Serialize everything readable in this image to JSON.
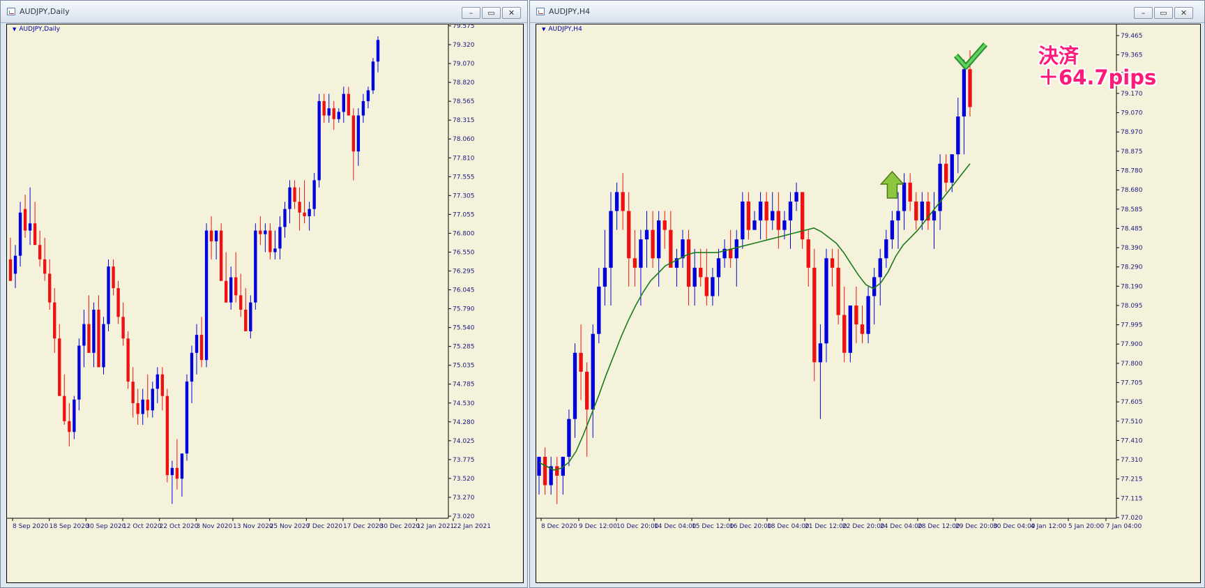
{
  "windows": [
    {
      "title": "AUDJPY,Daily",
      "chart_label": "AUDJPY,Daily",
      "y_ticks": [
        "79.575",
        "79.320",
        "79.070",
        "78.820",
        "78.565",
        "78.315",
        "78.060",
        "77.810",
        "77.555",
        "77.305",
        "77.055",
        "76.800",
        "76.550",
        "76.295",
        "76.045",
        "75.790",
        "75.540",
        "75.285",
        "75.035",
        "74.785",
        "74.530",
        "74.280",
        "74.025",
        "73.775",
        "73.520",
        "73.270",
        "73.020"
      ],
      "x_ticks": [
        "8 Sep 2020",
        "18 Sep 2020",
        "30 Sep 2020",
        "12 Oct 2020",
        "22 Oct 2020",
        "3 Nov 2020",
        "13 Nov 2020",
        "25 Nov 2020",
        "7 Dec 2020",
        "17 Dec 2020",
        "30 Dec 2020",
        "12 Jan 2021",
        "22 Jan 2021"
      ]
    },
    {
      "title": "AUDJPY,H4",
      "chart_label": "AUDJPY,H4",
      "y_ticks": [
        "79.465",
        "79.365",
        "79.265",
        "79.170",
        "79.070",
        "78.970",
        "78.875",
        "78.780",
        "78.680",
        "78.585",
        "78.485",
        "78.390",
        "78.290",
        "78.190",
        "78.095",
        "77.995",
        "77.900",
        "77.800",
        "77.705",
        "77.605",
        "77.510",
        "77.410",
        "77.310",
        "77.215",
        "77.115",
        "77.020"
      ],
      "x_ticks": [
        "8 Dec 2020",
        "9 Dec 12:00",
        "10 Dec 20:00",
        "14 Dec 04:00",
        "15 Dec 12:00",
        "16 Dec 20:00",
        "18 Dec 04:00",
        "21 Dec 12:00",
        "22 Dec 20:00",
        "24 Dec 04:00",
        "28 Dec 12:00",
        "29 Dec 20:00",
        "30 Dec 04:00",
        "4 Jan 12:00",
        "5 Jan 20:00",
        "7 Jan 04:00"
      ],
      "annotation": {
        "line1": "決済",
        "line2": "＋64.7pips"
      }
    }
  ],
  "colors": {
    "bull": "#0000dd",
    "bear": "#ee1111",
    "ma": "#1a7a1a",
    "chart_bg": "#f5f2dc",
    "axis_text": "#1a1a7a",
    "annotation": "#ff1a7a"
  },
  "icons": {
    "entry_arrow": "green-up-arrow-icon",
    "exit_check": "green-checkmark-icon"
  },
  "chart_data": [
    {
      "type": "candlestick",
      "title": "AUDJPY,Daily",
      "ylim": [
        72.9,
        79.65
      ],
      "candles": [
        [
          76.5,
          76.8,
          76.2,
          76.2
        ],
        [
          76.3,
          76.7,
          76.1,
          76.55
        ],
        [
          76.55,
          77.3,
          76.4,
          77.15
        ],
        [
          77.2,
          77.4,
          76.8,
          76.9
        ],
        [
          76.9,
          77.5,
          76.7,
          77.0
        ],
        [
          77.0,
          77.3,
          76.8,
          76.7
        ],
        [
          76.7,
          76.9,
          76.4,
          76.5
        ],
        [
          76.5,
          76.8,
          76.2,
          76.3
        ],
        [
          76.3,
          76.5,
          75.8,
          75.9
        ],
        [
          75.9,
          76.1,
          75.2,
          75.4
        ],
        [
          75.4,
          75.6,
          74.8,
          74.6
        ],
        [
          74.6,
          74.9,
          74.2,
          74.25
        ],
        [
          74.25,
          74.5,
          73.9,
          74.1
        ],
        [
          74.1,
          74.6,
          74.0,
          74.55
        ],
        [
          74.55,
          75.4,
          74.4,
          75.3
        ],
        [
          75.3,
          75.8,
          75.0,
          75.6
        ],
        [
          75.6,
          76.0,
          75.2,
          75.2
        ],
        [
          75.2,
          75.9,
          75.0,
          75.8
        ],
        [
          75.8,
          76.0,
          75.1,
          75.0
        ],
        [
          75.0,
          75.7,
          74.9,
          75.6
        ],
        [
          75.6,
          76.5,
          75.5,
          76.4
        ],
        [
          76.4,
          76.5,
          76.0,
          76.1
        ],
        [
          76.1,
          76.2,
          75.6,
          75.7
        ],
        [
          75.7,
          75.9,
          75.3,
          75.4
        ],
        [
          75.4,
          75.5,
          74.7,
          74.8
        ],
        [
          74.8,
          75.0,
          74.3,
          74.5
        ],
        [
          74.5,
          74.7,
          74.2,
          74.35
        ],
        [
          74.35,
          74.7,
          74.2,
          74.55
        ],
        [
          74.55,
          74.9,
          74.3,
          74.4
        ],
        [
          74.4,
          74.8,
          74.3,
          74.7
        ],
        [
          74.7,
          75.0,
          74.5,
          74.9
        ],
        [
          74.9,
          75.0,
          74.4,
          74.6
        ],
        [
          74.6,
          74.7,
          73.4,
          73.5
        ],
        [
          73.5,
          73.7,
          73.1,
          73.6
        ],
        [
          73.6,
          74.0,
          73.3,
          73.45
        ],
        [
          73.45,
          73.8,
          73.2,
          73.8
        ],
        [
          73.8,
          74.9,
          73.7,
          74.8
        ],
        [
          74.8,
          75.3,
          74.5,
          75.2
        ],
        [
          75.2,
          75.6,
          74.9,
          75.45
        ],
        [
          75.45,
          75.7,
          75.0,
          75.1
        ],
        [
          75.1,
          77.0,
          75.0,
          76.9
        ],
        [
          76.9,
          77.1,
          76.5,
          76.75
        ],
        [
          76.75,
          76.9,
          76.5,
          76.9
        ],
        [
          76.9,
          77.0,
          76.2,
          76.2
        ],
        [
          76.2,
          76.6,
          75.9,
          75.9
        ],
        [
          75.9,
          76.4,
          75.8,
          76.25
        ],
        [
          76.25,
          76.6,
          75.9,
          76.0
        ],
        [
          76.0,
          76.3,
          75.7,
          75.8
        ],
        [
          75.8,
          76.1,
          75.5,
          75.5
        ],
        [
          75.5,
          76.0,
          75.4,
          75.9
        ],
        [
          75.9,
          77.0,
          75.8,
          76.9
        ],
        [
          76.9,
          77.1,
          76.7,
          76.85
        ],
        [
          76.85,
          77.0,
          76.6,
          76.9
        ],
        [
          76.9,
          77.0,
          76.5,
          76.6
        ],
        [
          76.6,
          76.9,
          76.5,
          76.65
        ],
        [
          76.65,
          77.1,
          76.5,
          76.95
        ],
        [
          76.95,
          77.3,
          76.8,
          77.2
        ],
        [
          77.2,
          77.6,
          77.0,
          77.5
        ],
        [
          77.5,
          77.6,
          77.2,
          77.3
        ],
        [
          77.3,
          77.5,
          76.9,
          77.15
        ],
        [
          77.15,
          77.6,
          77.0,
          77.1
        ],
        [
          77.1,
          77.3,
          76.9,
          77.2
        ],
        [
          77.2,
          77.7,
          77.1,
          77.6
        ],
        [
          77.6,
          78.8,
          77.5,
          78.7
        ],
        [
          78.7,
          78.8,
          78.4,
          78.5
        ],
        [
          78.5,
          78.8,
          78.4,
          78.6
        ],
        [
          78.6,
          78.7,
          78.3,
          78.45
        ],
        [
          78.45,
          78.6,
          78.4,
          78.55
        ],
        [
          78.55,
          78.9,
          78.4,
          78.8
        ],
        [
          78.8,
          78.9,
          78.5,
          78.5
        ],
        [
          78.5,
          78.6,
          77.6,
          78.0
        ],
        [
          78.0,
          78.6,
          77.8,
          78.5
        ],
        [
          78.5,
          78.8,
          78.4,
          78.7
        ],
        [
          78.7,
          78.9,
          78.6,
          78.85
        ],
        [
          78.85,
          79.3,
          78.8,
          79.25
        ],
        [
          79.25,
          79.6,
          79.1,
          79.55
        ]
      ]
    },
    {
      "type": "candlestick",
      "title": "AUDJPY,H4",
      "ylim": [
        76.975,
        79.55
      ],
      "candles": [
        [
          77.2,
          77.3,
          77.1,
          77.3
        ],
        [
          77.3,
          77.35,
          77.1,
          77.15
        ],
        [
          77.15,
          77.3,
          77.1,
          77.25
        ],
        [
          77.25,
          77.3,
          77.05,
          77.2
        ],
        [
          77.2,
          77.3,
          77.1,
          77.3
        ],
        [
          77.3,
          77.55,
          77.25,
          77.5
        ],
        [
          77.5,
          77.9,
          77.4,
          77.85
        ],
        [
          77.85,
          78.0,
          77.6,
          77.75
        ],
        [
          77.75,
          77.8,
          77.3,
          77.55
        ],
        [
          77.55,
          78.0,
          77.4,
          77.95
        ],
        [
          77.95,
          78.3,
          77.9,
          78.2
        ],
        [
          78.2,
          78.5,
          78.1,
          78.3
        ],
        [
          78.3,
          78.7,
          78.1,
          78.6
        ],
        [
          78.6,
          78.75,
          78.5,
          78.7
        ],
        [
          78.7,
          78.8,
          78.5,
          78.6
        ],
        [
          78.6,
          78.7,
          78.2,
          78.35
        ],
        [
          78.35,
          78.5,
          78.2,
          78.3
        ],
        [
          78.3,
          78.5,
          78.1,
          78.45
        ],
        [
          78.45,
          78.6,
          78.3,
          78.5
        ],
        [
          78.5,
          78.6,
          78.3,
          78.35
        ],
        [
          78.35,
          78.6,
          78.2,
          78.55
        ],
        [
          78.55,
          78.6,
          78.4,
          78.5
        ],
        [
          78.5,
          78.6,
          78.3,
          78.3
        ],
        [
          78.3,
          78.4,
          78.2,
          78.35
        ],
        [
          78.35,
          78.5,
          78.3,
          78.45
        ],
        [
          78.45,
          78.5,
          78.1,
          78.2
        ],
        [
          78.2,
          78.4,
          78.1,
          78.3
        ],
        [
          78.3,
          78.4,
          78.2,
          78.25
        ],
        [
          78.25,
          78.4,
          78.1,
          78.15
        ],
        [
          78.15,
          78.3,
          78.1,
          78.25
        ],
        [
          78.25,
          78.4,
          78.15,
          78.35
        ],
        [
          78.35,
          78.45,
          78.3,
          78.4
        ],
        [
          78.4,
          78.5,
          78.3,
          78.35
        ],
        [
          78.35,
          78.5,
          78.2,
          78.45
        ],
        [
          78.45,
          78.7,
          78.4,
          78.65
        ],
        [
          78.65,
          78.7,
          78.45,
          78.5
        ],
        [
          78.5,
          78.6,
          78.5,
          78.55
        ],
        [
          78.55,
          78.7,
          78.45,
          78.65
        ],
        [
          78.65,
          78.7,
          78.45,
          78.55
        ],
        [
          78.55,
          78.7,
          78.5,
          78.6
        ],
        [
          78.6,
          78.7,
          78.4,
          78.5
        ],
        [
          78.5,
          78.6,
          78.45,
          78.55
        ],
        [
          78.55,
          78.7,
          78.4,
          78.65
        ],
        [
          78.65,
          78.75,
          78.6,
          78.7
        ],
        [
          78.7,
          78.6,
          78.4,
          78.45
        ],
        [
          78.45,
          78.5,
          78.2,
          78.3
        ],
        [
          78.3,
          78.4,
          77.7,
          77.8
        ],
        [
          77.8,
          78.0,
          77.5,
          77.9
        ],
        [
          77.9,
          78.4,
          77.8,
          78.35
        ],
        [
          78.35,
          78.4,
          78.2,
          78.3
        ],
        [
          78.3,
          78.4,
          78.0,
          78.05
        ],
        [
          78.05,
          78.2,
          77.8,
          77.85
        ],
        [
          77.85,
          78.1,
          77.8,
          78.1
        ],
        [
          78.1,
          78.2,
          77.9,
          78.0
        ],
        [
          78.0,
          78.1,
          77.9,
          77.95
        ],
        [
          77.95,
          78.2,
          77.9,
          78.15
        ],
        [
          78.15,
          78.3,
          78.0,
          78.25
        ],
        [
          78.25,
          78.4,
          78.1,
          78.35
        ],
        [
          78.35,
          78.5,
          78.3,
          78.45
        ],
        [
          78.45,
          78.6,
          78.4,
          78.55
        ],
        [
          78.55,
          78.7,
          78.4,
          78.6
        ],
        [
          78.6,
          78.8,
          78.5,
          78.75
        ],
        [
          78.75,
          78.8,
          78.6,
          78.65
        ],
        [
          78.65,
          78.7,
          78.5,
          78.55
        ],
        [
          78.55,
          78.7,
          78.5,
          78.65
        ],
        [
          78.65,
          78.7,
          78.5,
          78.55
        ],
        [
          78.55,
          78.7,
          78.4,
          78.6
        ],
        [
          78.6,
          78.9,
          78.5,
          78.85
        ],
        [
          78.85,
          78.9,
          78.7,
          78.75
        ],
        [
          78.75,
          78.9,
          78.7,
          78.9
        ],
        [
          78.9,
          79.2,
          78.8,
          79.1
        ],
        [
          79.1,
          79.4,
          78.9,
          79.35
        ],
        [
          79.35,
          79.45,
          79.1,
          79.15
        ]
      ],
      "ma": [
        77.27,
        77.25,
        77.23,
        77.24,
        77.27,
        77.33,
        77.42,
        77.52,
        77.62,
        77.73,
        77.83,
        77.93,
        78.02,
        78.1,
        78.17,
        78.23,
        78.27,
        78.31,
        78.33,
        78.35,
        78.37,
        78.38,
        78.38,
        78.38,
        78.38,
        78.39,
        78.4,
        78.41,
        78.42,
        78.43,
        78.44,
        78.45,
        78.46,
        78.47,
        78.48,
        78.49,
        78.5,
        78.51,
        78.49,
        78.46,
        78.43,
        78.38,
        78.32,
        78.26,
        78.21,
        78.19,
        78.22,
        78.28,
        78.36,
        78.42,
        78.46,
        78.5,
        78.55,
        78.6,
        78.65,
        78.7,
        78.75,
        78.8,
        78.85
      ]
    }
  ]
}
